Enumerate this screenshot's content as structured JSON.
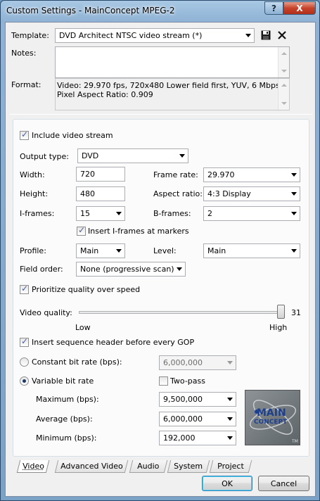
{
  "window": {
    "title": "Custom Settings - MainConcept MPEG-2",
    "help_label": "?",
    "close_label": "X"
  },
  "template": {
    "label": "Template:",
    "value": "DVD Architect NTSC video stream (*)"
  },
  "notes": {
    "label": "Notes:",
    "value": ""
  },
  "format": {
    "label": "Format:",
    "line1": "Video: 29.970 fps, 720x480 Lower field first, YUV, 6 Mbps",
    "line2": "Pixel Aspect Ratio: 0.909"
  },
  "video": {
    "include_stream_label": "Include video stream",
    "include_stream_checked": true,
    "output_type_label": "Output type:",
    "output_type_value": "DVD",
    "width_label": "Width:",
    "width_value": "720",
    "height_label": "Height:",
    "height_value": "480",
    "frame_rate_label": "Frame rate:",
    "frame_rate_value": "29.970",
    "aspect_label": "Aspect ratio:",
    "aspect_value": "4:3 Display",
    "iframes_label": "I-frames:",
    "iframes_value": "15",
    "bframes_label": "B-frames:",
    "bframes_value": "2",
    "insert_iframes_label": "Insert I-frames at markers",
    "insert_iframes_checked": true,
    "profile_label": "Profile:",
    "profile_value": "Main",
    "level_label": "Level:",
    "level_value": "Main",
    "field_order_label": "Field order:",
    "field_order_value": "None (progressive scan)",
    "prioritize_label": "Prioritize quality over speed",
    "prioritize_checked": true,
    "quality_label": "Video quality:",
    "quality_value": "31",
    "quality_fraction": 0.99,
    "quality_low": "Low",
    "quality_high": "High",
    "seq_header_label": "Insert sequence header before every GOP",
    "seq_header_checked": true,
    "cbr_label": "Constant bit rate (bps):",
    "cbr_value": "6,000,000",
    "vbr_label": "Variable bit rate",
    "two_pass_label": "Two-pass",
    "two_pass_checked": false,
    "max_label": "Maximum (bps):",
    "max_value": "9,500,000",
    "avg_label": "Average (bps):",
    "avg_value": "6,000,000",
    "min_label": "Minimum (bps):",
    "min_value": "192,000",
    "logo_line1": "MAIN",
    "logo_line2": "CONCEPT",
    "logo_tm": "TM"
  },
  "tabs": [
    "Video",
    "Advanced Video",
    "Audio",
    "System",
    "Project"
  ],
  "buttons": {
    "ok": "OK",
    "cancel": "Cancel"
  },
  "colors": {
    "title_bar": "#8fb2d4",
    "close_button": "#c7432b",
    "logo_text": "#1d3f8f"
  }
}
